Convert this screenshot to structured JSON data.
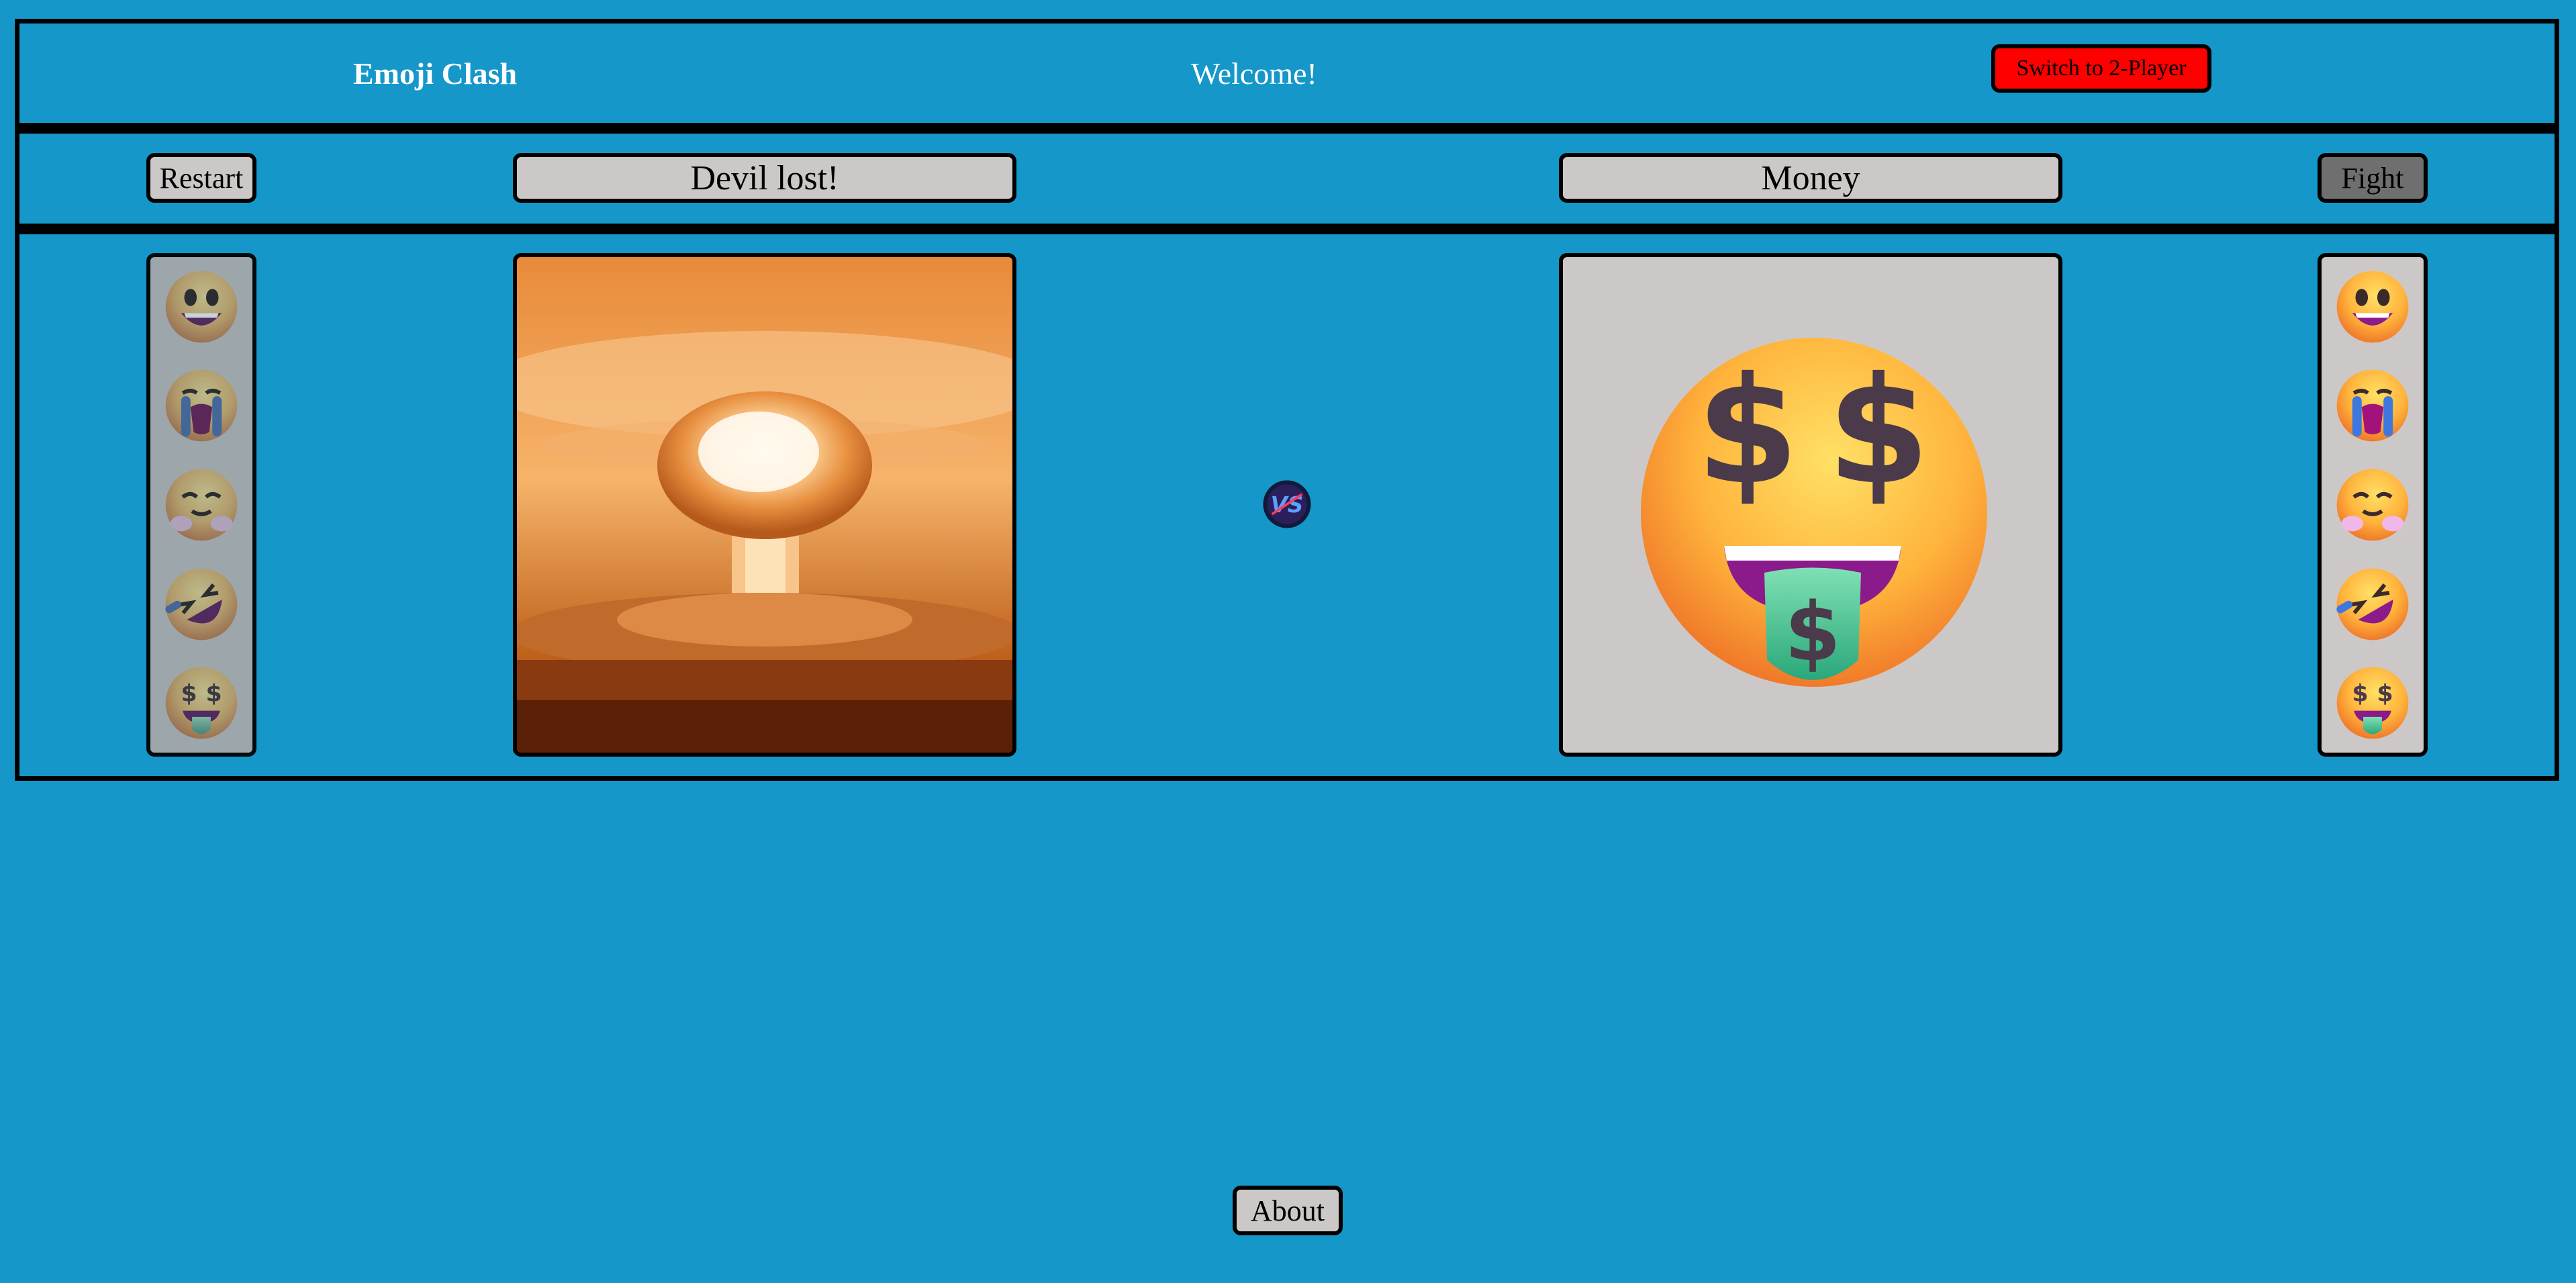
{
  "header": {
    "title": "Emoji Clash",
    "welcome": "Welcome!",
    "mode_button": "Switch to 2-Player"
  },
  "controls": {
    "restart_label": "Restart",
    "left_status": "Devil lost!",
    "right_choice": "Money",
    "fight_label": "Fight"
  },
  "left_column": {
    "emojis": [
      "grinning-face",
      "loudly-crying-face",
      "smiling-face-with-tear",
      "rolling-on-floor-laughing",
      "money-mouth-face"
    ],
    "state": "disabled"
  },
  "right_column": {
    "emojis": [
      "grinning-face",
      "loudly-crying-face",
      "smiling-face-with-tear",
      "rolling-on-floor-laughing",
      "money-mouth-face"
    ],
    "state": "active"
  },
  "left_panel": {
    "image": "mushroom-cloud-explosion"
  },
  "right_panel": {
    "image": "money-mouth-face"
  },
  "vs_icon": "vs-badge",
  "footer": {
    "about_label": "About"
  },
  "colors": {
    "background": "#1597c9",
    "button_gray": "#cdc8c8",
    "fight_button": "#6f6f6f",
    "switch_button": "#ff0000"
  }
}
